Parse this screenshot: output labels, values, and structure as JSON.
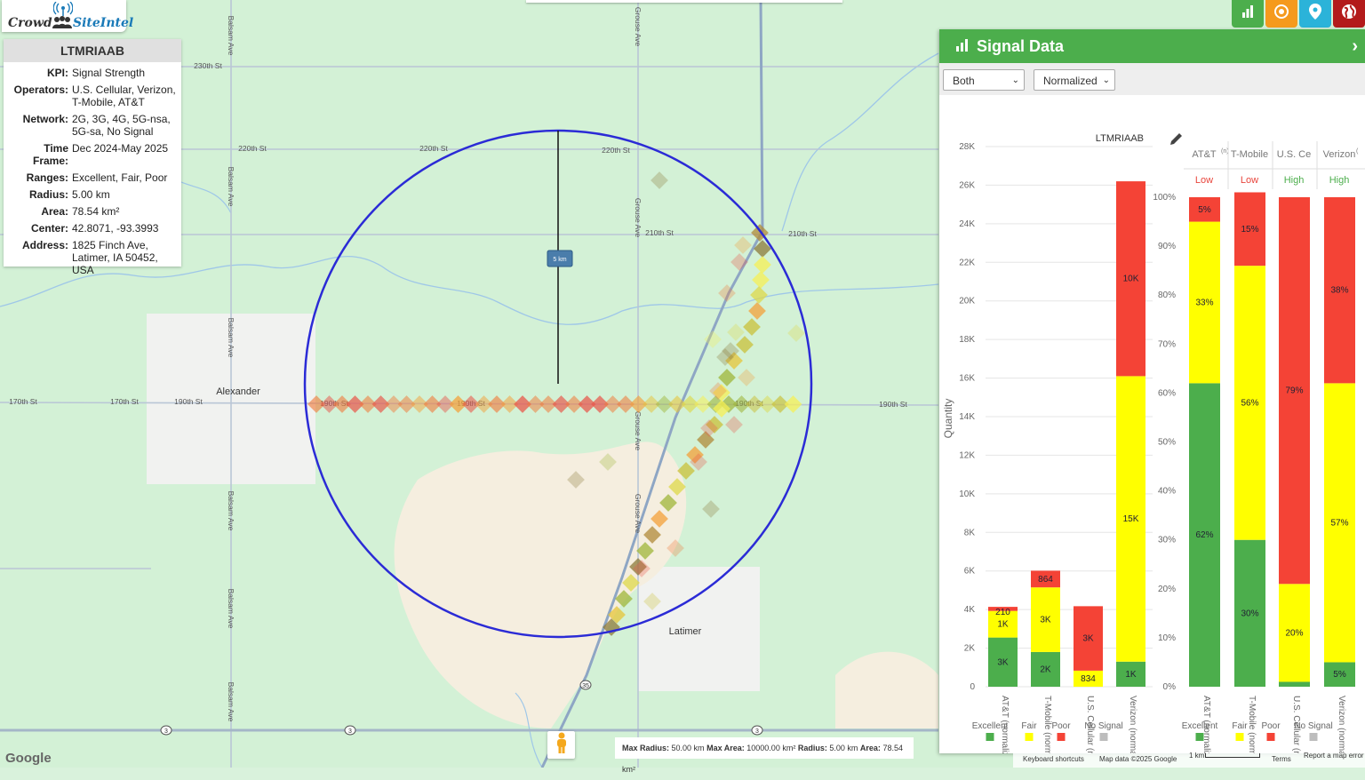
{
  "logo": {
    "crowd": "Crowd",
    "siteintel": "SiteIntel"
  },
  "info": {
    "title": "LTMRIAAB",
    "rows": [
      {
        "k": "KPI:",
        "v": "Signal Strength"
      },
      {
        "k": "Operators:",
        "v": "U.S. Cellular, Verizon, T-Mobile, AT&T"
      },
      {
        "k": "Network:",
        "v": "2G, 3G, 4G, 5G-nsa, 5G-sa, No Signal"
      },
      {
        "k": "Time Frame:",
        "v": "Dec 2024-May 2025"
      },
      {
        "k": "Ranges:",
        "v": "Excellent, Fair, Poor"
      },
      {
        "k": "Radius:",
        "v": "5.00 km"
      },
      {
        "k": "Area:",
        "v": "78.54 km²"
      },
      {
        "k": "Center:",
        "v": "42.8071, -93.3993"
      },
      {
        "k": "Address:",
        "v": "1825 Finch Ave, Latimer, IA 50452, USA"
      }
    ]
  },
  "top_buttons": [
    {
      "icon": "bar-chart-icon",
      "color": "#4cae4c"
    },
    {
      "icon": "target-icon",
      "color": "#f59a1d"
    },
    {
      "icon": "map-pin-icon",
      "color": "#2bb3d9"
    },
    {
      "icon": "globe-icon",
      "color": "#b31b1b"
    }
  ],
  "map": {
    "roads": [
      "230th St",
      "220th St",
      "220th St",
      "220th St",
      "210th St",
      "210th St",
      "170th St",
      "170th St",
      "190th St",
      "190th St",
      "190th St",
      "190th St",
      "190th St",
      "Balsam Ave",
      "Balsam Ave",
      "Balsam Ave",
      "Balsam Ave",
      "Balsam Ave",
      "Balsam Ave",
      "Grouse Ave",
      "Grouse Ave",
      "Grouse Ave",
      "Grouse Ave"
    ],
    "places": [
      "Alexander",
      "Latimer"
    ],
    "radius_label": "5 km",
    "highway_labels": [
      "3",
      "3",
      "3",
      "35"
    ],
    "bottom_info": {
      "max_radius_label": "Max Radius:",
      "max_radius": "50.00 km",
      "max_area_label": "Max Area:",
      "max_area": "10000.00 km²",
      "radius_label": "Radius:",
      "radius": "5.00 km",
      "area_label": "Area:",
      "area": "78.54 km²"
    },
    "google": "Google",
    "footer": {
      "shortcuts": "Keyboard shortcuts",
      "mapdata": "Map data ©2025 Google",
      "scale": "1 km",
      "terms": "Terms",
      "report": "Report a map error"
    }
  },
  "panel": {
    "title": "Signal Data",
    "select1": "Both",
    "select2": "Normalized",
    "site": "LTMRIAAB",
    "legend": [
      "Excellent",
      "Fair",
      "Poor",
      "No Signal"
    ],
    "ops_header": [
      {
        "name": "AT&T",
        "sup": "(n)",
        "rating": "Low",
        "color": "#e8453c"
      },
      {
        "name": "T-Mobile",
        "sup": "",
        "rating": "Low",
        "color": "#e8453c"
      },
      {
        "name": "U.S. Ce",
        "sup": "",
        "rating": "High",
        "color": "#4cae4c"
      },
      {
        "name": "Verizon",
        "sup": "(",
        "rating": "High",
        "color": "#4cae4c"
      }
    ]
  },
  "colors": {
    "excellent": "#4cae4c",
    "fair": "#ffff00",
    "poor": "#f44336",
    "nosignal": "#bdbdbd"
  },
  "chart_data": [
    {
      "type": "bar",
      "stacked": true,
      "title": "LTMRIAAB",
      "ylabel": "Quantity",
      "ylim": [
        0,
        28000
      ],
      "y_ticks": [
        "0",
        "2K",
        "4K",
        "6K",
        "8K",
        "10K",
        "12K",
        "14K",
        "16K",
        "18K",
        "20K",
        "22K",
        "24K",
        "26K",
        "28K"
      ],
      "categories": [
        "AT&T (normalized)",
        "T-Mobile (normalized)",
        "U.S. Cellular (normalized)",
        "Verizon (normalized)"
      ],
      "series": [
        {
          "name": "Excellent",
          "values": [
            2550,
            1800,
            0,
            1300
          ],
          "labels": [
            "3K",
            "2K",
            "",
            "1K"
          ]
        },
        {
          "name": "Fair",
          "values": [
            1380,
            3350,
            834,
            14800
          ],
          "labels": [
            "1K",
            "3K",
            "834",
            "15K"
          ]
        },
        {
          "name": "Poor",
          "values": [
            210,
            864,
            3340,
            10100
          ],
          "labels": [
            "210",
            "864",
            "3K",
            "10K"
          ]
        }
      ]
    },
    {
      "type": "bar",
      "stacked": true,
      "ylim": [
        0,
        100
      ],
      "y_ticks": [
        "0%",
        "10%",
        "20%",
        "30%",
        "40%",
        "50%",
        "60%",
        "70%",
        "80%",
        "90%",
        "100%"
      ],
      "categories": [
        "AT&T (normalized)",
        "T-Mobile (normalized)",
        "U.S. Cellular (normalized)",
        "Verizon (normalized)"
      ],
      "series": [
        {
          "name": "Excellent",
          "values": [
            62,
            30,
            1,
            5
          ],
          "labels": [
            "62%",
            "30%",
            "",
            "5%"
          ]
        },
        {
          "name": "Fair",
          "values": [
            33,
            56,
            20,
            57
          ],
          "labels": [
            "33%",
            "56%",
            "20%",
            "57%"
          ]
        },
        {
          "name": "Poor",
          "values": [
            5,
            15,
            79,
            38
          ],
          "labels": [
            "5%",
            "15%",
            "79%",
            "38%"
          ]
        }
      ]
    }
  ]
}
